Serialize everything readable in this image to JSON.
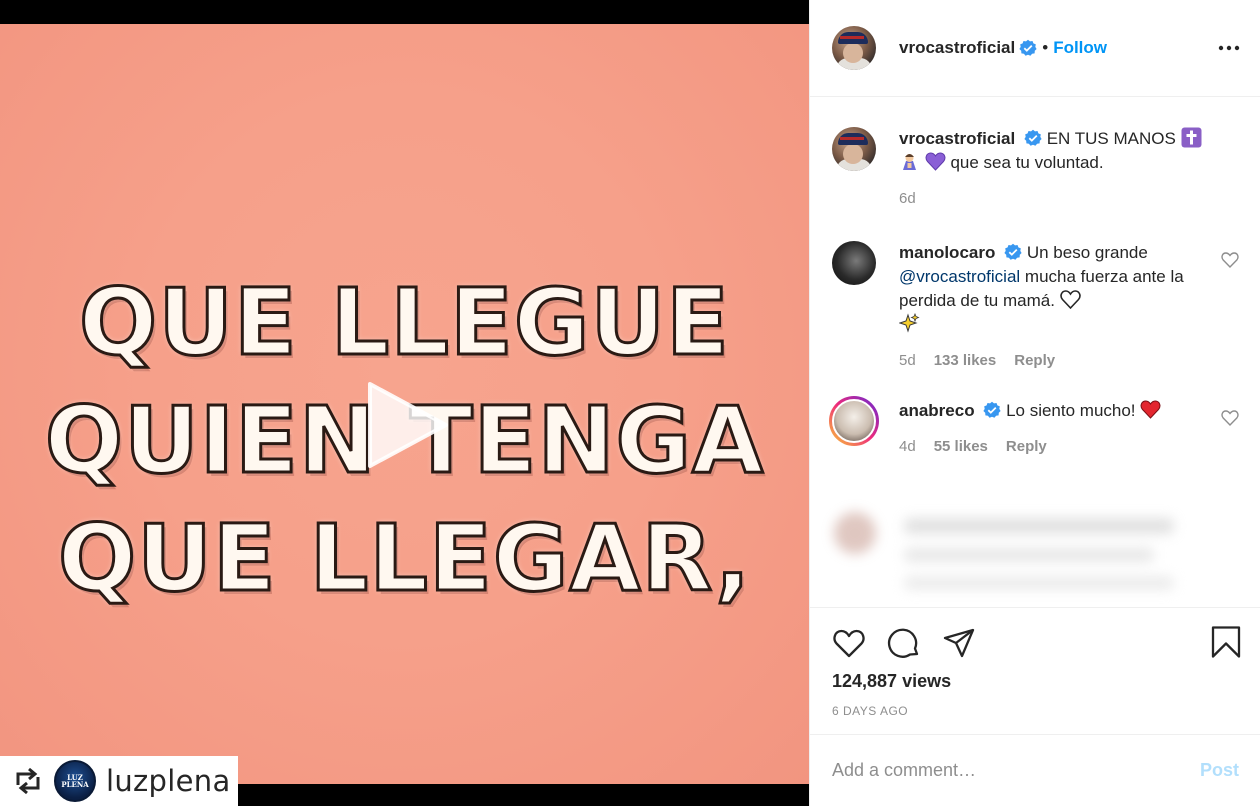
{
  "media": {
    "lyrics": [
      "QUE LLEGUE",
      "QUIEN TENGA",
      "QUE LLEGAR,"
    ],
    "repost_username": "luzplena",
    "repost_logo_text": "LUZ PLENA"
  },
  "header": {
    "username": "vrocastroficial",
    "separator": "•",
    "follow_label": "Follow"
  },
  "caption": {
    "username": "vrocastroficial",
    "text_1": "EN TUS MANOS",
    "text_2": "que sea tu voluntad.",
    "time": "6d"
  },
  "comments": [
    {
      "username": "manolocaro",
      "text_1": "Un beso grande",
      "mention": "@vrocastroficial",
      "text_2": "mucha fuerza ante la perdida de tu mamá.",
      "time": "5d",
      "likes": "133 likes",
      "reply": "Reply"
    },
    {
      "username": "anabreco",
      "text_1": "Lo siento mucho!",
      "time": "4d",
      "likes": "55 likes",
      "reply": "Reply"
    }
  ],
  "stats": {
    "views": "124,887 views",
    "date": "6 DAYS AGO"
  },
  "composer": {
    "placeholder": "Add a comment…",
    "post_label": "Post"
  },
  "colors": {
    "accent": "#0095f6",
    "video_bg": "#f6a08a",
    "post_disabled": "#b2dffc"
  }
}
